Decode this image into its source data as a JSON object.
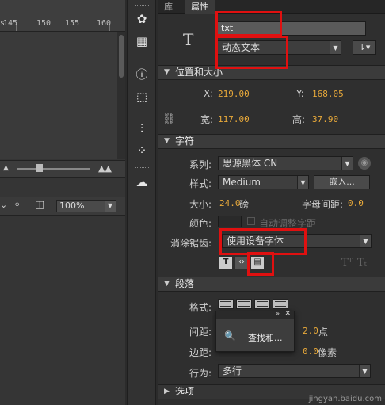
{
  "timeline": {
    "ruler_numbers": [
      "s",
      "145",
      "150",
      "155",
      "160"
    ],
    "zoom_value": "100%"
  },
  "toolstrip": {
    "icons": [
      "palette-icon",
      "grid-icon",
      "info-icon",
      "transform-icon",
      "align-icon",
      "motion-icon",
      "cc-library-icon"
    ]
  },
  "panel": {
    "tabs": [
      "库",
      "属性"
    ],
    "instance_name": "txt",
    "text_type": "动态文本",
    "sections": {
      "position": "位置和大小",
      "character": "字符",
      "paragraph": "段落",
      "options": "选项"
    },
    "position": {
      "x_label": "X:",
      "x_value": "219.00",
      "y_label": "Y:",
      "y_value": "168.05",
      "w_label": "宽:",
      "w_value": "117.00",
      "h_label": "高:",
      "h_value": "37.90"
    },
    "character": {
      "family_label": "系列:",
      "family_value": "思源黑体 CN",
      "style_label": "样式:",
      "style_value": "Medium",
      "embed_label": "嵌入...",
      "size_label": "大小:",
      "size_value": "24.0",
      "size_unit": "磅",
      "spacing_label": "字母间距:",
      "spacing_value": "0.0",
      "color_label": "颜色:",
      "autokern_label": "自动调整字距",
      "aa_label": "消除锯齿:",
      "aa_value": "使用设备字体"
    },
    "paragraph": {
      "format_label": "格式:",
      "spacing_label": "间距:",
      "spacing_value": "2.0",
      "spacing_unit": "点",
      "margin_label": "边距:",
      "margin_value": "0.0",
      "margin_unit": "像素",
      "behavior_label": "行为:",
      "behavior_value": "多行"
    },
    "popup_label": "查找和..."
  },
  "watermark": "jingyan.baidu.com",
  "colors": {
    "accent_value": "#e8a93a",
    "highlight_box": "#e01010"
  }
}
